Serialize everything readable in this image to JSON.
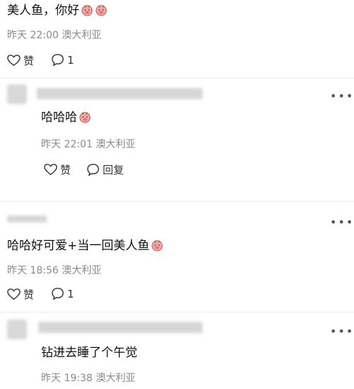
{
  "post": {
    "text": "美人鱼，你好",
    "emoji_count": 2,
    "time": "昨天 22:00",
    "location": "澳大利亚",
    "like_label": "赞",
    "comment_count": "1"
  },
  "comments": [
    {
      "reply": {
        "text": "哈哈哈",
        "time": "昨天 22:01",
        "location": "澳大利亚",
        "like_label": "赞",
        "reply_label": "回复"
      }
    },
    {
      "text": "哈哈好可爱+当一回美人鱼",
      "time": "昨天 18:56",
      "location": "澳大利亚",
      "like_label": "赞",
      "comment_count": "1"
    },
    {
      "reply": {
        "text": "钻进去睡了个午觉",
        "time": "昨天 19:38",
        "location": "澳大利亚"
      }
    }
  ],
  "more_icon": "more-dots-icon",
  "emoji_icon": "pig-face-icon"
}
